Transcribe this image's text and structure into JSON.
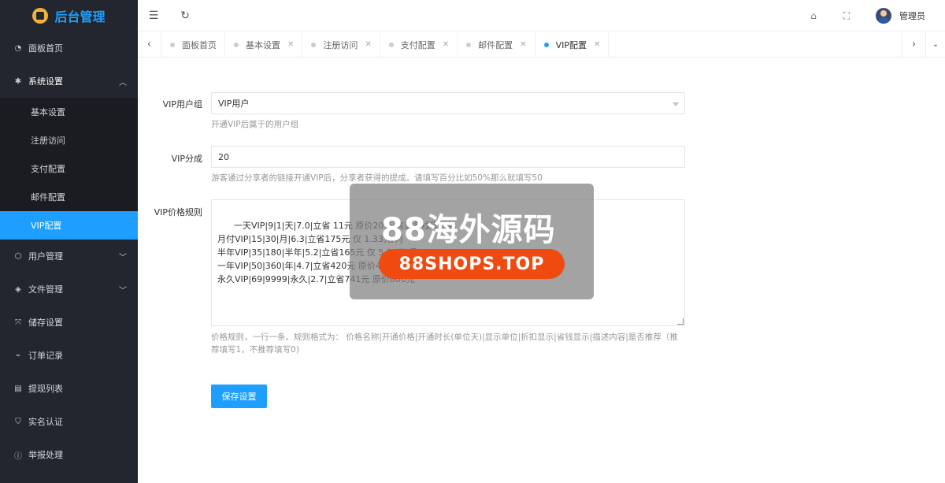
{
  "app": {
    "title": "后台管理"
  },
  "sidebar": {
    "items": [
      {
        "label": "面板首页",
        "icon": "dashboard-icon"
      },
      {
        "label": "系统设置",
        "icon": "gear-icon"
      },
      {
        "label": "用户管理",
        "icon": "cube-icon"
      },
      {
        "label": "文件管理",
        "icon": "layers-icon"
      },
      {
        "label": "储存设置",
        "icon": "storage-icon"
      },
      {
        "label": "订单记录",
        "icon": "pulse-icon"
      },
      {
        "label": "提现列表",
        "icon": "list-icon"
      },
      {
        "label": "实名认证",
        "icon": "shield-icon"
      },
      {
        "label": "举报处理",
        "icon": "alert-icon"
      }
    ],
    "sub_items": [
      "基本设置",
      "注册访问",
      "支付配置",
      "邮件配置",
      "VIP配置"
    ],
    "active_sub": "VIP配置"
  },
  "topbar": {
    "user": "管理员"
  },
  "tabs": [
    {
      "label": "面板首页"
    },
    {
      "label": "基本设置"
    },
    {
      "label": "注册访问"
    },
    {
      "label": "支付配置"
    },
    {
      "label": "邮件配置"
    },
    {
      "label": "VIP配置"
    }
  ],
  "form": {
    "group": {
      "label": "VIP用户组",
      "value": "VIP用户",
      "help": "开通VIP后属于的用户组"
    },
    "share": {
      "label": "VIP分成",
      "value": "20",
      "help": "游客通过分享者的链接开通VIP后，分享者获得的提成。请填写百分比如50%那么就填写50"
    },
    "price": {
      "label": "VIP价格规则",
      "value": "一天VIP|9|1|天|7.0|立省 11元 原价20元|高速多线程下载\n月付VIP|15|30|月|6.3|立省175元 仅 1.33元/月\n半年VIP|35|180|半年|5.2|立省165元 仅 5.83元/月\n一年VIP|50|360|年|4.7|立省420元 原价450元|高速多线程\n永久VIP|69|9999|永久|2.7|立省741元 原价800元",
      "help": "价格规则，一行一条。规则格式为：  价格名称|开通价格|开通时长(单位天)|显示单位|折扣显示|省钱显示|描述内容|是否推荐（推荐填写1，不推荐填写0)"
    },
    "save_label": "保存设置"
  },
  "watermark": {
    "text": "88海外源码",
    "url": "88SHOPS.TOP"
  },
  "colors": {
    "sidebar_bg": "#23262e",
    "accent": "#1E9FFF",
    "watermark_pill": "#f04a10"
  }
}
